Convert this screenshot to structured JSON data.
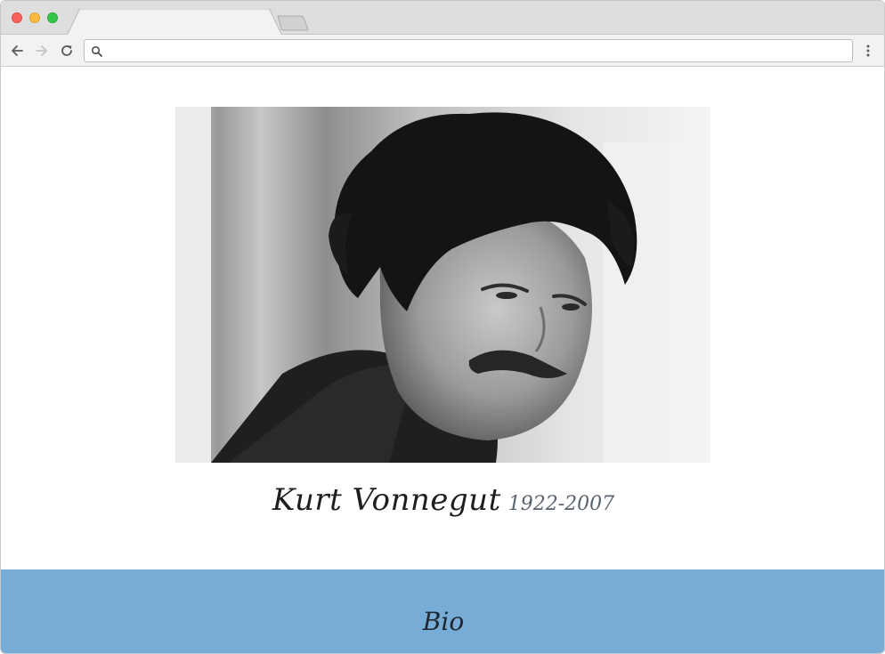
{
  "browser": {
    "address": {
      "value": "",
      "placeholder": ""
    },
    "colors": {
      "traffic_close": "#fc605c",
      "traffic_minimize": "#fcbb40",
      "traffic_maximize": "#34c84a"
    }
  },
  "page": {
    "portrait": {
      "icon": "portrait-photo-icon"
    },
    "name": "Kurt Vonnegut",
    "years": "1922-2007",
    "bio_label": "Bio",
    "colors": {
      "bio_band": "#77acd6",
      "name_text": "#1e1e1e",
      "years_text": "#5a6470"
    }
  }
}
